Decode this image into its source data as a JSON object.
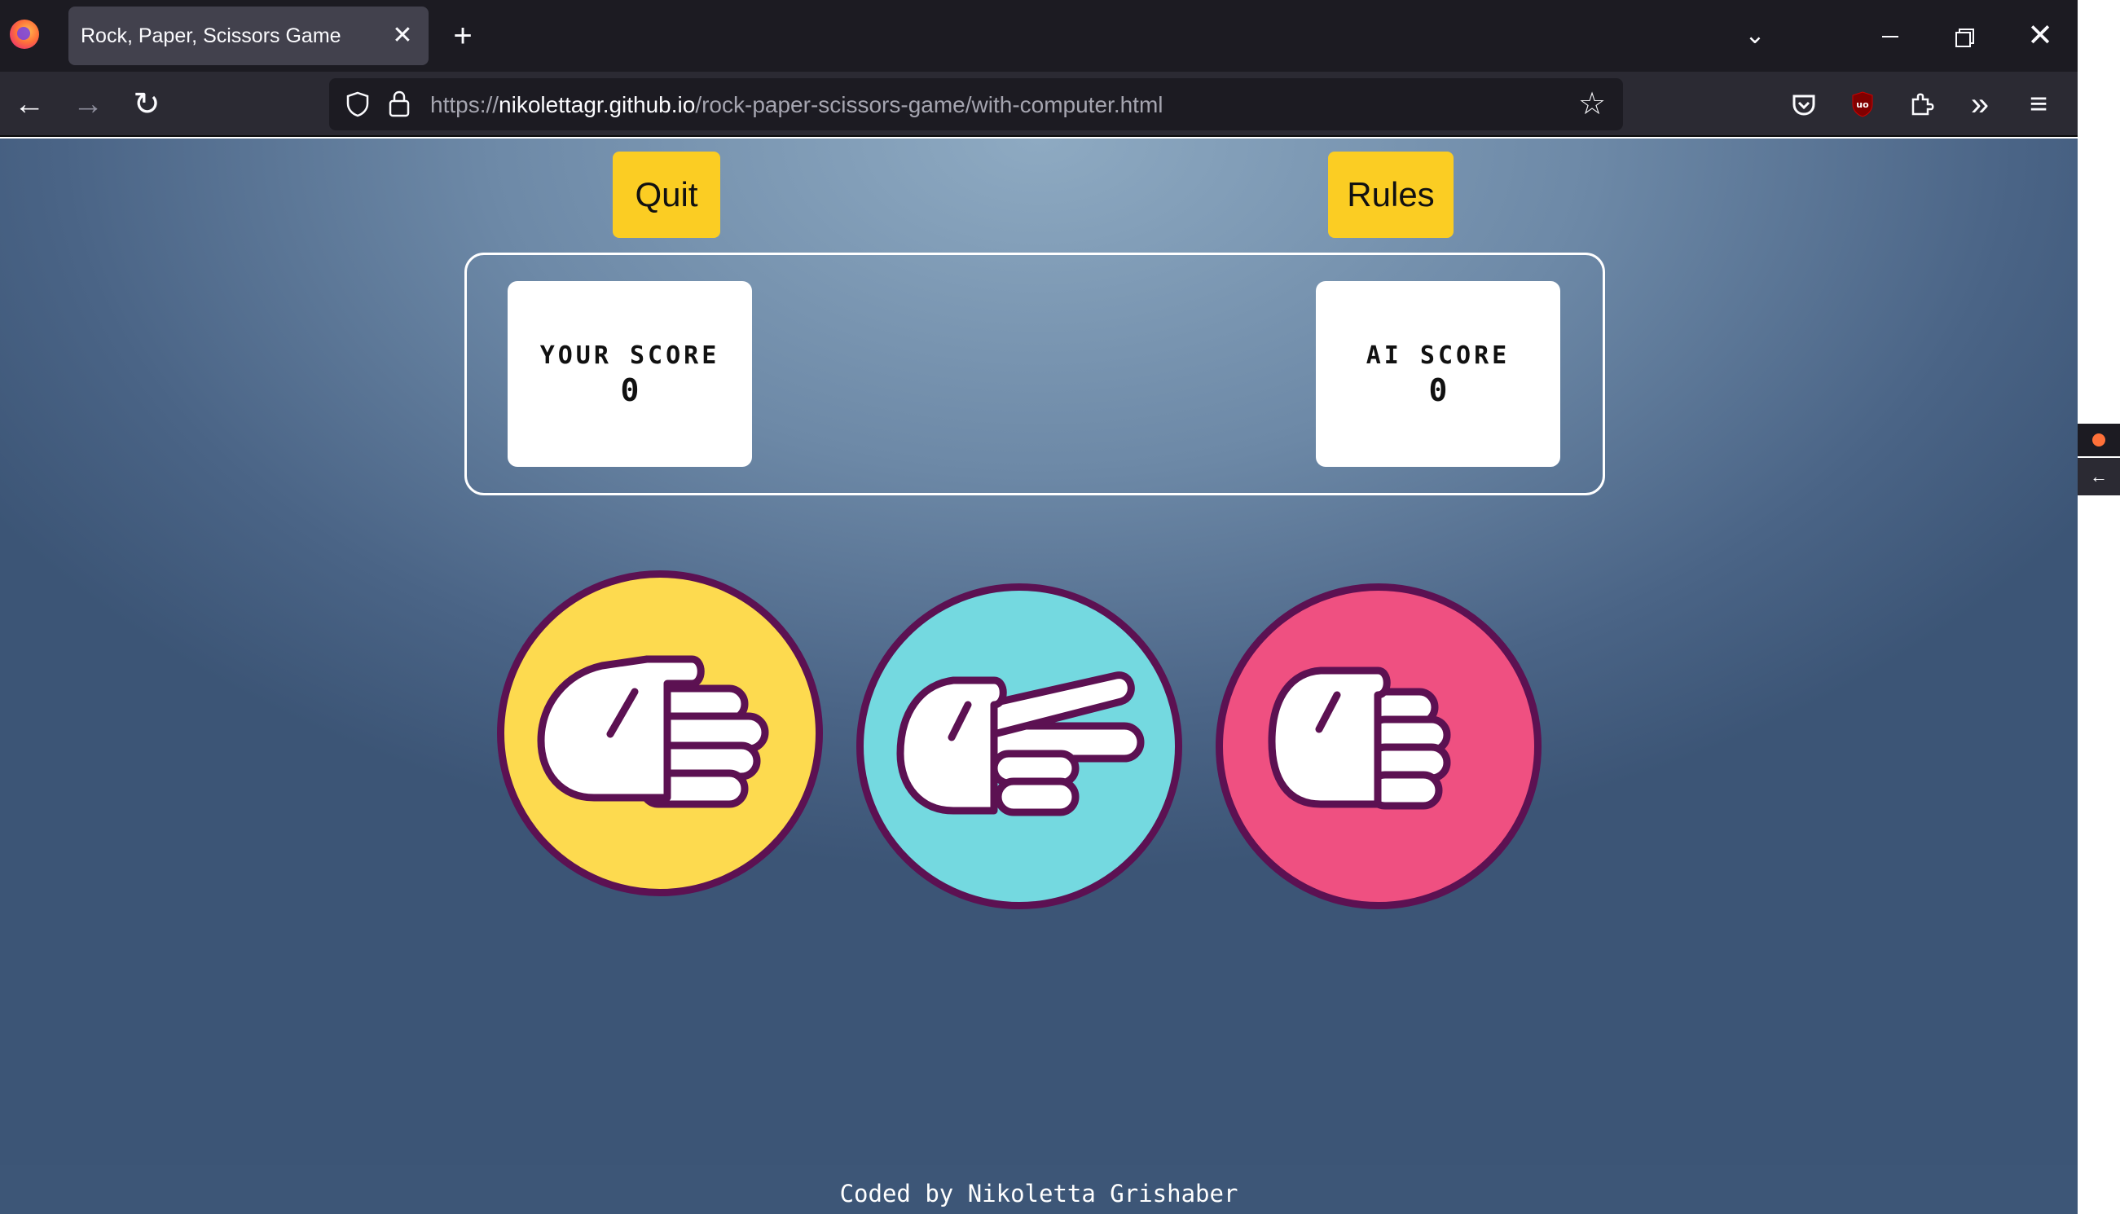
{
  "browser": {
    "tab_title": "Rock, Paper, Scissors Game",
    "tab_close": "✕",
    "new_tab": "+",
    "tabs_dropdown": "⌄",
    "window_close": "✕",
    "nav": {
      "back": "←",
      "forward": "→",
      "reload": "↻"
    },
    "url": {
      "prefix": "https://",
      "host": "nikolettagr.github.io",
      "path": "/rock-paper-scissors-game/with-computer.html"
    },
    "toolbar": {
      "star": "☆",
      "pocket": "pocket-icon",
      "ublock": "ublock-origin-icon",
      "extensions": "puzzle-icon",
      "overflow": "»",
      "menu": "≡"
    },
    "side_strip": {
      "arrow": "←"
    }
  },
  "game": {
    "quit_label": "Quit",
    "rules_label": "Rules",
    "your_score_label": "YOUR SCORE",
    "your_score_value": "0",
    "ai_score_label": "AI SCORE",
    "ai_score_value": "0",
    "choices": [
      {
        "name": "paper",
        "color": "#fdda4f"
      },
      {
        "name": "scissors",
        "color": "#74d9e0"
      },
      {
        "name": "rock",
        "color": "#ef5081"
      }
    ],
    "outline_color": "#5c1152",
    "button_color": "#fbcd23"
  },
  "footer": {
    "credit": "Coded by Nikoletta Grishaber"
  }
}
